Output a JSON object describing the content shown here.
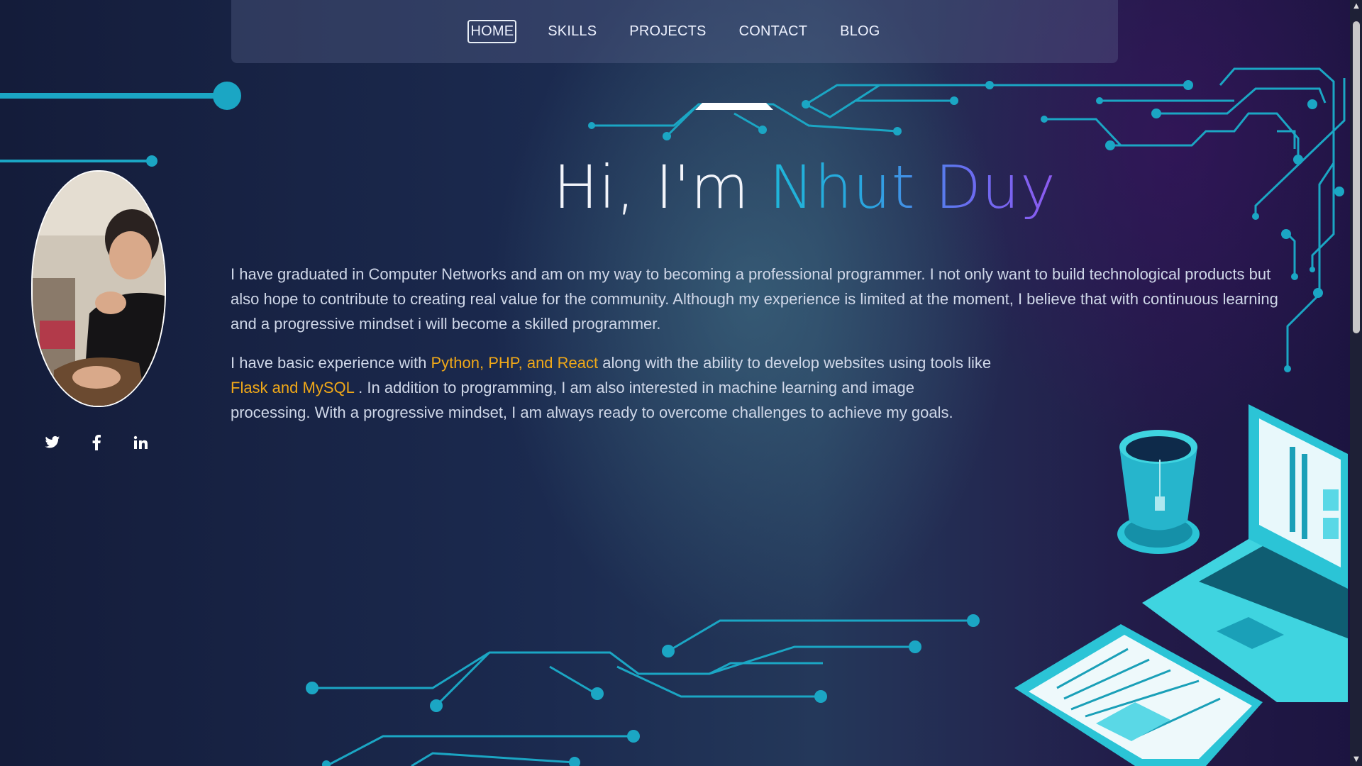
{
  "nav": {
    "items": [
      {
        "label": "HOME",
        "active": true
      },
      {
        "label": "SKILLS",
        "active": false
      },
      {
        "label": "PROJECTS",
        "active": false
      },
      {
        "label": "CONTACT",
        "active": false
      },
      {
        "label": "BLOG",
        "active": false
      }
    ]
  },
  "hero": {
    "greeting": "Hi, I'm ",
    "name": "Nhut Duy"
  },
  "about": {
    "paragraph1": "I have graduated in Computer Networks and am on my way to becoming a professional programmer. I not only want to build technological products but also hope to contribute to creating real value for the community. Although my experience is limited at the moment, I believe that with continuous learning and a progressive mindset i will become a skilled programmer.",
    "p2_part1": "I have basic experience with ",
    "p2_highlight1": "Python, PHP, and React",
    "p2_part2": " along with the ability to develop websites using tools like ",
    "p2_highlight2": "Flask and MySQL",
    "p2_part3": " . In addition to programming, I am also interested in machine learning and image processing. With a progressive mindset, I am always ready to overcome challenges to achieve my goals."
  },
  "social": {
    "icons": [
      "twitter-icon",
      "facebook-icon",
      "linkedin-icon"
    ]
  },
  "colors": {
    "accent_cyan": "#1fb6d8",
    "accent_purple": "#8e5af0",
    "highlight": "#f0a818",
    "circuit": "#1ba6c4"
  }
}
